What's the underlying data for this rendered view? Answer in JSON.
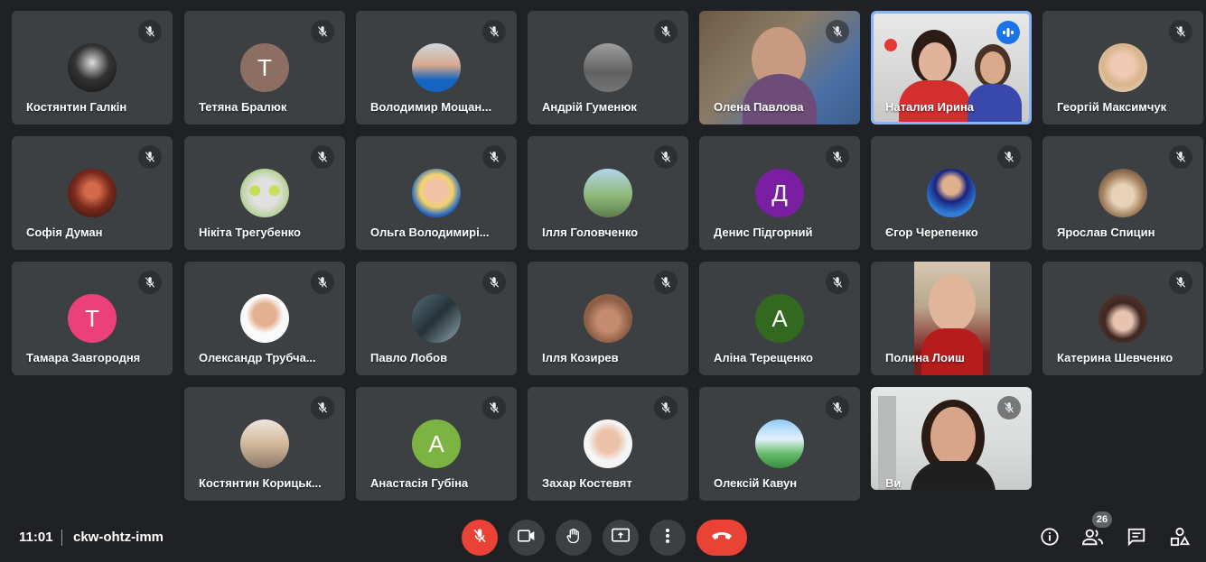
{
  "meeting": {
    "time": "11:01",
    "code": "ckw-ohtz-imm",
    "participant_count": "26"
  },
  "colors": {
    "background": "#202124",
    "tile": "#3c4043",
    "speaking_border": "#8ab4f8",
    "danger": "#ea4335"
  },
  "participants": [
    {
      "name": "Костянтин Галкін",
      "avatar": "photo",
      "muted": true
    },
    {
      "name": "Тетяна Бралюк",
      "avatar": "initial",
      "initial": "Т",
      "avatar_color": "#8d6e63",
      "muted": true
    },
    {
      "name": "Володимир Мощан...",
      "avatar": "photo",
      "muted": true
    },
    {
      "name": "Андрій Гуменюк",
      "avatar": "photo",
      "muted": true
    },
    {
      "name": "Олена Павлова",
      "avatar": "video",
      "muted": true
    },
    {
      "name": "Наталия Ирина",
      "avatar": "video",
      "muted": false,
      "speaking": true
    },
    {
      "name": "Георгій Максимчук",
      "avatar": "photo",
      "muted": true
    },
    {
      "name": "Софія Думан",
      "avatar": "photo",
      "muted": true
    },
    {
      "name": "Нікіта Трегубенко",
      "avatar": "photo",
      "muted": true
    },
    {
      "name": "Ольга Володимирі...",
      "avatar": "photo",
      "muted": true
    },
    {
      "name": "Ілля Головченко",
      "avatar": "photo",
      "muted": true
    },
    {
      "name": "Денис Підгорний",
      "avatar": "initial",
      "initial": "Д",
      "avatar_color": "#7b1fa2",
      "muted": true
    },
    {
      "name": "Єгор Черепенко",
      "avatar": "photo",
      "muted": true
    },
    {
      "name": "Ярослав Спицин",
      "avatar": "photo",
      "muted": true
    },
    {
      "name": "Тамара Завгородня",
      "avatar": "initial",
      "initial": "Т",
      "avatar_color": "#ec407a",
      "muted": true
    },
    {
      "name": "Олександр Трубча...",
      "avatar": "photo",
      "muted": true
    },
    {
      "name": "Павло Лобов",
      "avatar": "photo",
      "muted": true
    },
    {
      "name": "Ілля Козирев",
      "avatar": "photo",
      "muted": true
    },
    {
      "name": "Аліна Терещенко",
      "avatar": "initial",
      "initial": "А",
      "avatar_color": "#33691e",
      "muted": true
    },
    {
      "name": "Полина Лоиш",
      "avatar": "video",
      "muted": false
    },
    {
      "name": "Катерина Шевченко",
      "avatar": "photo",
      "muted": true
    },
    {
      "name": "Костянтин Корицьк...",
      "avatar": "photo",
      "muted": true
    },
    {
      "name": "Анастасія Губіна",
      "avatar": "initial",
      "initial": "А",
      "avatar_color": "#7cb342",
      "muted": true
    },
    {
      "name": "Захар Костевят",
      "avatar": "photo",
      "muted": true
    },
    {
      "name": "Олексій Кавун",
      "avatar": "photo",
      "muted": true
    },
    {
      "name": "Ви",
      "avatar": "video",
      "muted": true
    }
  ],
  "controls": {
    "mic": "mic-off-icon",
    "camera": "camera-icon",
    "raise_hand": "hand-icon",
    "present": "present-icon",
    "more": "more-vert-icon",
    "end_call": "end-call-icon",
    "info": "info-icon",
    "people": "people-icon",
    "chat": "chat-icon",
    "activities": "activities-icon"
  }
}
